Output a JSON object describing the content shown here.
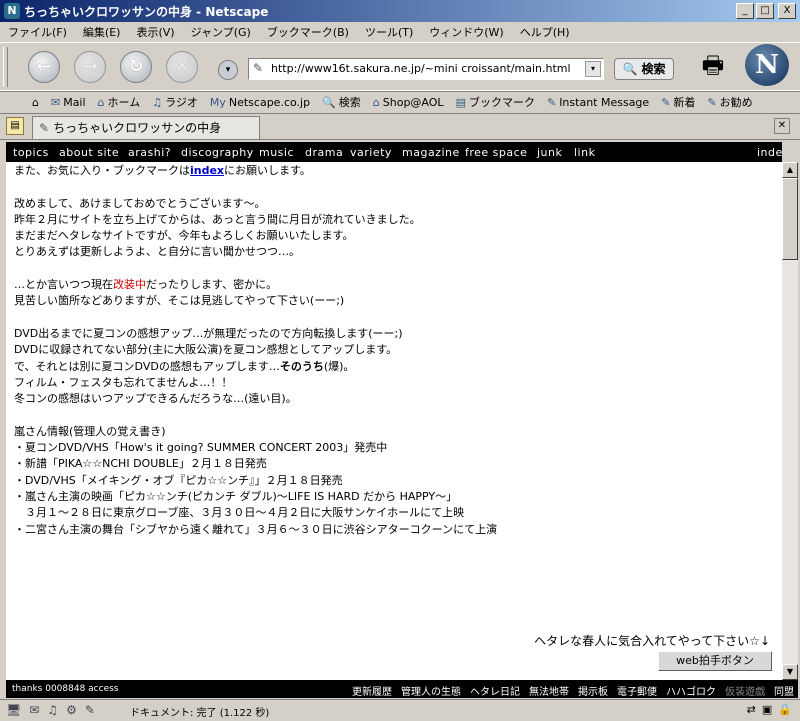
{
  "window": {
    "title": "ちっちゃいクロワッサンの中身 - Netscape",
    "app_icon": "N",
    "btn_min": "_",
    "btn_max": "□",
    "btn_close": "X"
  },
  "menu": [
    "ファイル(F)",
    "編集(E)",
    "表示(V)",
    "ジャンプ(G)",
    "ブックマーク(B)",
    "ツール(T)",
    "ウィンドウ(W)",
    "ヘルプ(H)"
  ],
  "nav": {
    "back_glyph": "←",
    "forward_glyph": "→",
    "reload_glyph": "↻",
    "stop_glyph": "✕",
    "history_glyph": "▾",
    "url": "http://www16t.sakura.ne.jp/~mini croissant/main.html",
    "url_dropdown_glyph": "▾",
    "search_label": "🔍 検索",
    "print_glyph": "🖶",
    "logo": "N"
  },
  "bookmarks": [
    {
      "icon": "✉",
      "label": "Mail"
    },
    {
      "icon": "⌂",
      "label": "ホーム"
    },
    {
      "icon": "♫",
      "label": "ラジオ"
    },
    {
      "icon": "My",
      "label": "Netscape.co.jp"
    },
    {
      "icon": "🔍",
      "label": "検索"
    },
    {
      "icon": "⌂",
      "label": "Shop@AOL"
    },
    {
      "icon": "▤",
      "label": "ブックマーク"
    },
    {
      "icon": "✎",
      "label": "Instant Message"
    },
    {
      "icon": "✎",
      "label": "新着"
    },
    {
      "icon": "✎",
      "label": "お勧め"
    }
  ],
  "bookmark_home_glyph": "⌂",
  "tab": {
    "icon": "✎",
    "label": "ちっちゃいクロワッサンの中身",
    "close_glyph": "✕",
    "sidebar_glyph": "▤"
  },
  "sitenav": {
    "links": [
      "topics",
      "about site",
      "arashi?",
      "discography",
      "music",
      "drama",
      "variety",
      "magazine",
      "free space",
      "junk",
      "link"
    ],
    "index": "index"
  },
  "content": {
    "l1_a": "また、お気に入り・ブックマークは",
    "l1_link": "index",
    "l1_b": "にお願いします。",
    "p1": [
      "改めまして、あけましておめでとうございます〜。",
      "昨年２月にサイトを立ち上げてからは、あっと言う間に月日が流れていきました。",
      "まだまだヘタレなサイトですが、今年もよろしくお願いいたします。",
      "とりあえずは更新しようよ、と自分に言い聞かせつつ…。"
    ],
    "p2_a": "…とか言いつつ現在",
    "p2_red": "改装中",
    "p2_b": "だったりします、密かに。",
    "p2_l2": "見苦しい箇所などありますが、そこは見逃してやって下さい(ーー;)",
    "p3_l1": "DVD出るまでに夏コンの感想アップ…が無理だったので方向転換します(ーー;)",
    "p3_l2": "DVDに収録されてない部分(主に大阪公演)を夏コン感想としてアップします。",
    "p3_l3a": "で、それとは別に夏コンDVDの感想もアップします…",
    "p3_l3b": "そのうち",
    "p3_l3c": "(爆)。",
    "p3_l4": "フィルム・フェスタも忘れてませんよ…！！",
    "p3_l5": "冬コンの感想はいつアップできるんだろうな…(遠い目)。",
    "info": [
      "嵐さん情報(管理人の覚え書き)",
      "・夏コンDVD/VHS「How's it going? SUMMER CONCERT 2003」発売中",
      "・新譜「PIKA☆☆NCHI DOUBLE」２月１８日発売",
      "・DVD/VHS「メイキング・オブ『ピカ☆☆ンチ』」２月１８日発売",
      "・嵐さん主演の映画「ピカ☆☆ンチ(ピカンチ ダブル)〜LIFE IS HARD だから HAPPY〜」",
      "　３月１〜２８日に東京グローブ座、３月３０日〜４月２日に大阪サンケイホールにて上映",
      "・二宮さん主演の舞台「シブヤから遠く離れて」３月６〜３０日に渋谷シアターコクーンにて上演"
    ],
    "footnote": "ヘタレな春人に気合入れてやって下さい☆↓",
    "clap_button": "web拍手ボタン"
  },
  "footer": {
    "counter": "thanks 0008848 access",
    "links": [
      "更新履歴",
      "管理人の生態",
      "ヘタレ日記",
      "無法地帯",
      "掲示板",
      "電子郵便",
      "ハハゴロク"
    ],
    "disabled_link": "仮装遊戯",
    "last_link": "同盟"
  },
  "statusbar": {
    "icons": [
      "🖥",
      "✉",
      "♫",
      "⚙",
      "✎"
    ],
    "text": "ドキュメント: 完了 (1.122 秒)",
    "right_icons": [
      "⇄",
      "▣",
      "🔒"
    ]
  },
  "scrollbar": {
    "up": "▲",
    "down": "▼"
  }
}
